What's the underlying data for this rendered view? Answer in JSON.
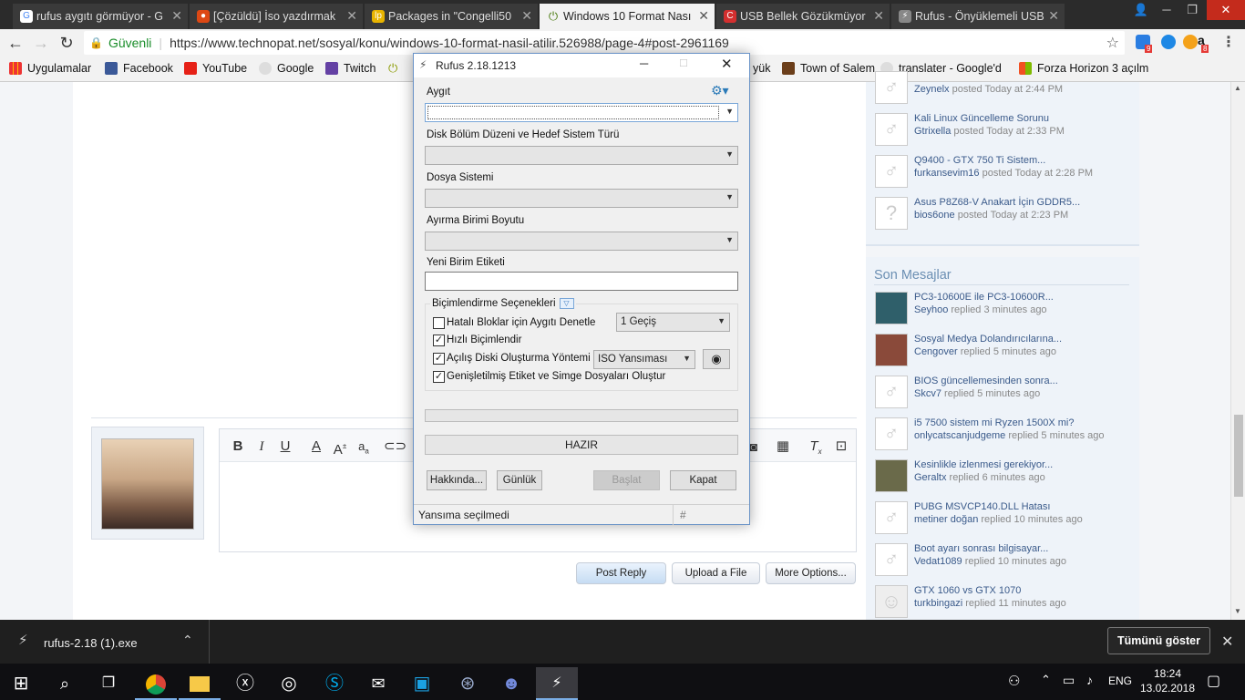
{
  "browser": {
    "tabs": [
      {
        "title": "rufus aygıtı görmüyor - G",
        "icon": "google-icon"
      },
      {
        "title": "[Çözüldü] İso yazdırmak",
        "icon": "ubuntu-icon"
      },
      {
        "title": "Packages in \"Congelli50",
        "icon": "launchpad-icon"
      },
      {
        "title": "Windows 10 Format Nası",
        "icon": "technopat-icon"
      },
      {
        "title": "USB Bellek Gözükmüyor",
        "icon": "site-icon"
      },
      {
        "title": "Rufus - Önyüklemeli USB",
        "icon": "rufus-icon"
      }
    ],
    "secure_label": "Güvenli",
    "url": "https://www.technopat.net/sosyal/konu/windows-10-format-nasil-atilir.526988/page-4#post-2961169",
    "ext_badges": [
      "9",
      "8"
    ],
    "bookmarks": [
      "Uygulamalar",
      "Facebook",
      "YouTube",
      "Google",
      "Twitch",
      "Town of Salem",
      "translater - Google'd",
      "Forza Horizon 3 açılm"
    ],
    "bookmark_partial": "yük"
  },
  "sidebar": {
    "top_threads": [
      {
        "title": "",
        "user": "Zeynelx",
        "time": "posted Today at 2:44 PM"
      },
      {
        "title": "Kali Linux Güncelleme Sorunu",
        "user": "Gtrixella",
        "time": "posted Today at 2:33 PM"
      },
      {
        "title": "Q9400 - GTX 750 Ti Sistem...",
        "user": "furkansevim16",
        "time": "posted Today at 2:28 PM"
      },
      {
        "title": "Asus P8Z68-V Anakart İçin GDDR5...",
        "user": "bios6one",
        "time": "posted Today at 2:23 PM"
      }
    ],
    "son_mesajlar_title": "Son Mesajlar",
    "recent": [
      {
        "title": "PC3-10600E ile PC3-10600R...",
        "user": "Seyhoo",
        "time": "replied 3 minutes ago"
      },
      {
        "title": "Sosyal Medya Dolandırıcılarına...",
        "user": "Cengover",
        "time": "replied 5 minutes ago"
      },
      {
        "title": "BIOS güncellemesinden sonra...",
        "user": "Skcv7",
        "time": "replied 5 minutes ago"
      },
      {
        "title": "i5 7500 sistem mi Ryzen 1500X mi?",
        "user": "onlycatscanjudgeme",
        "time": "replied 5 minutes ago"
      },
      {
        "title": "Kesinlikle izlenmesi gerekiyor...",
        "user": "Geraltx",
        "time": "replied 6 minutes ago"
      },
      {
        "title": "PUBG MSVCP140.DLL Hatası",
        "user": "metiner doğan",
        "time": "replied 10 minutes ago"
      },
      {
        "title": "Boot ayarı sonrası bilgisayar...",
        "user": "Vedat1089",
        "time": "replied 10 minutes ago"
      },
      {
        "title": "GTX 1060 vs GTX 1070",
        "user": "turkbingazi",
        "time": "replied 11 minutes ago"
      }
    ]
  },
  "reply": {
    "post_reply": "Post Reply",
    "upload": "Upload a File",
    "more": "More Options..."
  },
  "rufus": {
    "title": "Rufus 2.18.1213",
    "device_label": "Aygıt",
    "partition_label": "Disk Bölüm Düzeni ve Hedef Sistem Türü",
    "filesystem_label": "Dosya Sistemi",
    "cluster_label": "Ayırma Birimi Boyutu",
    "volume_label": "Yeni Birim Etiketi",
    "format_options": "Biçimlendirme Seçenekleri",
    "badblocks": "Hatalı Bloklar için Aygıtı Denetle",
    "passes": "1 Geçiş",
    "quick": "Hızlı Biçimlendir",
    "bootable": "Açılış Diski Oluşturma Yöntemi",
    "image_type": "ISO Yansıması",
    "extended": "Genişletilmiş Etiket ve Simge Dosyaları Oluştur",
    "status": "HAZIR",
    "about": "Hakkında...",
    "log": "Günlük",
    "start": "Başlat",
    "close": "Kapat",
    "statusbar": "Yansıma seçilmedi",
    "hash": "#"
  },
  "download": {
    "file": "rufus-2.18 (1).exe",
    "show_all": "Tümünü göster"
  },
  "taskbar": {
    "lang": "ENG",
    "time": "18:24",
    "date": "13.02.2018"
  }
}
